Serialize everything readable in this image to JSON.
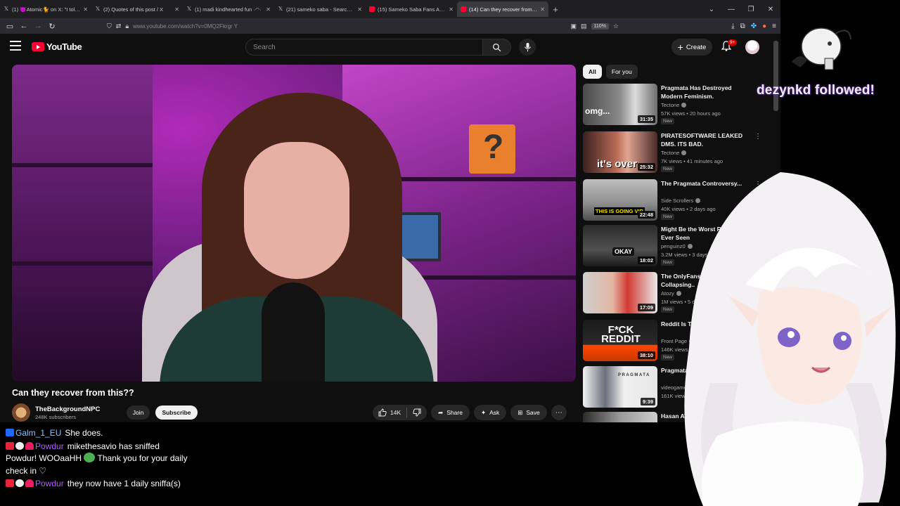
{
  "browser": {
    "tabs": [
      {
        "title": "(1) 😈Atomic🐈 on X: \"I told m",
        "icon": "x-icon",
        "active": false
      },
      {
        "title": "(2) Quotes of this post / X",
        "icon": "x-icon",
        "active": false
      },
      {
        "title": "(1) madi kindhearted fun ·◠·",
        "icon": "x-icon",
        "active": false
      },
      {
        "title": "(21) sameko saba - Search / X",
        "icon": "x-icon",
        "active": false
      },
      {
        "title": "(15) Sameko Saba Fans Are HA",
        "icon": "youtube-icon",
        "active": false
      },
      {
        "title": "(14) Can they recover from this",
        "icon": "youtube-icon",
        "active": true
      }
    ],
    "url": "www.youtube.com/watch?v=0MQ2Fkrgr Y",
    "zoom": "110%"
  },
  "youtube": {
    "logo_text": "YouTube",
    "search_placeholder": "Search",
    "create_label": "Create",
    "notif_count": "9+",
    "video": {
      "title": "Can they recover from this??",
      "channel": "TheBackgroundNPC",
      "subscribers": "248K subscribers",
      "join_label": "Join",
      "subscribe_label": "Subscribe",
      "likes": "14K",
      "share_label": "Share",
      "ask_label": "Ask",
      "save_label": "Save"
    },
    "chips": [
      "All",
      "For you"
    ],
    "recommendations": [
      {
        "title": "Pragmata Has Destroyed Modern Feminism.",
        "channel": "Tectone",
        "meta": "57K views • 20 hours ago",
        "duration": "31:35",
        "badge": "New",
        "thumb_text": "omg..."
      },
      {
        "title": "PIRATESOFTWARE LEAKED DMS. ITS BAD.",
        "channel": "Tectone",
        "meta": "7K views • 41 minutes ago",
        "duration": "25:32",
        "badge": "New",
        "thumb_text": "it's over"
      },
      {
        "title": "The Pragmata Controversy...",
        "channel": "Side Scrollers",
        "meta": "40K views • 2 days ago",
        "duration": "22:48",
        "badge": "New",
        "thumb_text": "THIS IS GOING VIR"
      },
      {
        "title": "Might Be the Worst Review Ever Seen",
        "channel": "penguinz0",
        "meta": "3.2M views • 3 days ago",
        "duration": "18:02",
        "badge": "New",
        "thumb_text": "OKAY"
      },
      {
        "title": "The OnlyFans Empire Is Collapsing..",
        "channel": "Atozy",
        "meta": "1M views • 5 days ago",
        "duration": "17:09",
        "badge": "New",
        "thumb_text": ""
      },
      {
        "title": "Reddit Is The Worst",
        "channel": "Front Page",
        "meta": "146K views • 2 days ago",
        "duration": "38:10",
        "badge": "New",
        "thumb_text": "F*CK REDDIT"
      },
      {
        "title": "Pragmata",
        "channel": "videogamedunkey",
        "meta": "161K views • 3 hours ago",
        "duration": "9:39",
        "badge": "New",
        "thumb_text": "PRAGMATA"
      },
      {
        "title": "Hasan ATTACKS Pragmata",
        "channel": "",
        "meta": "",
        "duration": "",
        "badge": "",
        "thumb_text": ""
      }
    ]
  },
  "stream": {
    "follow_alert": "dezynkd followed!",
    "chat": [
      {
        "user": "Galm_1_EU",
        "user_color": "#7ec8ff",
        "text": "She does.",
        "badges": [
          "mod"
        ]
      },
      {
        "user": "Powdur",
        "user_color": "#b25bff",
        "text": "mikethesavio has sniffed Powdur! WOOaaHH",
        "text2": "Thank you for your daily check in ♡",
        "badges": [
          "cam",
          "wolf",
          "heart"
        ]
      },
      {
        "user": "Powdur",
        "user_color": "#b25bff",
        "text": "they now have 1 daily sniffa(s)",
        "badges": [
          "cam",
          "wolf",
          "heart"
        ]
      }
    ]
  }
}
